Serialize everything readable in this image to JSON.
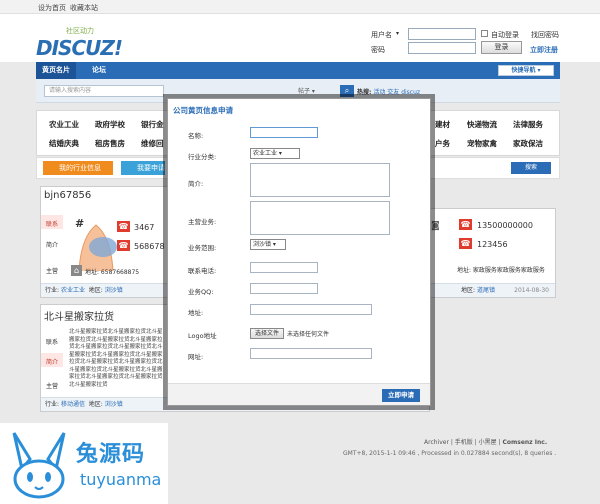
{
  "topbar": {
    "set_home": "设为首页",
    "bookmark": "收藏本站"
  },
  "header": {
    "logo_text": "DISCUZ!",
    "logo_slogan": "社区动力",
    "username_label": "用户名",
    "password_label": "密码",
    "auto_login": "自动登录",
    "find_password": "找回密码",
    "login_button": "登录",
    "register": "立即注册"
  },
  "nav": {
    "items": [
      "黄页名片",
      "论坛"
    ],
    "quick_nav": "快捷导航"
  },
  "search": {
    "placeholder": "请输入搜索内容",
    "scope": "帖子",
    "hot_label": "热搜:",
    "hot_terms": [
      "活动",
      "交友",
      "discuz"
    ]
  },
  "categories": {
    "row1": [
      "农业工业",
      "政府学校",
      "银行金",
      "建材",
      "快递物流",
      "法律服务"
    ],
    "row2": [
      "结婚庆典",
      "租房售房",
      "维修回",
      "户务",
      "宠物家禽",
      "家政保洁"
    ]
  },
  "tabs": {
    "my_info": "我的行业信息",
    "apply": "我要申请",
    "search_btn": "搜索"
  },
  "cards": [
    {
      "title": "bjn67856",
      "contact_label": "联系",
      "intro_label": "简介",
      "main_label": "主营",
      "phone1": "3467",
      "phone2": "568678",
      "address": "地址: 6587668875",
      "industry_label": "行业:",
      "industry": "农业工业",
      "region_label": "地区:",
      "region": "浏沙镇"
    },
    {
      "phone1": "13500000000",
      "phone2": "123456",
      "address": "地址: 家政服务家政服务家政服务",
      "region_label": "地区:",
      "region": "道尾镇",
      "date": "2014-08-30"
    },
    {
      "title": "北斗星搬家拉货",
      "contact_label": "联系",
      "intro_label": "简介",
      "main_label": "主营",
      "text_lines": [
        "北斗星搬家拉货北斗星搬家拉货北斗星",
        "搬家拉货北斗星搬家拉货北斗星搬家拉",
        "货北斗星搬家拉货北斗星搬家拉货北斗",
        "星搬家拉货北斗星搬家拉货北斗星搬家",
        "拉货北斗星搬家拉货北斗星搬家拉货北",
        "斗星搬家拉货北斗星搬家拉货北斗星搬",
        "家拉货北斗星搬家拉货北斗星搬家拉货",
        "北斗星搬家拉货"
      ],
      "industry_label": "行业:",
      "industry": "移动通信",
      "region_label": "地区:",
      "region": "浏沙镇"
    }
  ],
  "footer": {
    "links": [
      "Archiver",
      "手机版",
      "小黑屋",
      "Comsenz Inc."
    ],
    "gmt": "GMT+8, 2015-1-1 09:46 , Processed in 0.027884 second(s), 8 queries ."
  },
  "watermark": {
    "cn": "兔源码",
    "en": "tuyuanma"
  },
  "dialog": {
    "title": "公司黄页信息申请",
    "fields": {
      "name": "名称:",
      "industry": "行业分类:",
      "intro": "简介:",
      "main_business": "主营业务:",
      "service_area": "业务范围:",
      "phone": "联系电话:",
      "qq": "业务QQ:",
      "address": "地址:",
      "logo": "Logo地址",
      "website": "网址:"
    },
    "industry_selected": "农业工业",
    "area_selected": "浏沙镇",
    "file_button": "选择文件",
    "file_none": "未选择任何文件",
    "submit": "立即申请"
  }
}
